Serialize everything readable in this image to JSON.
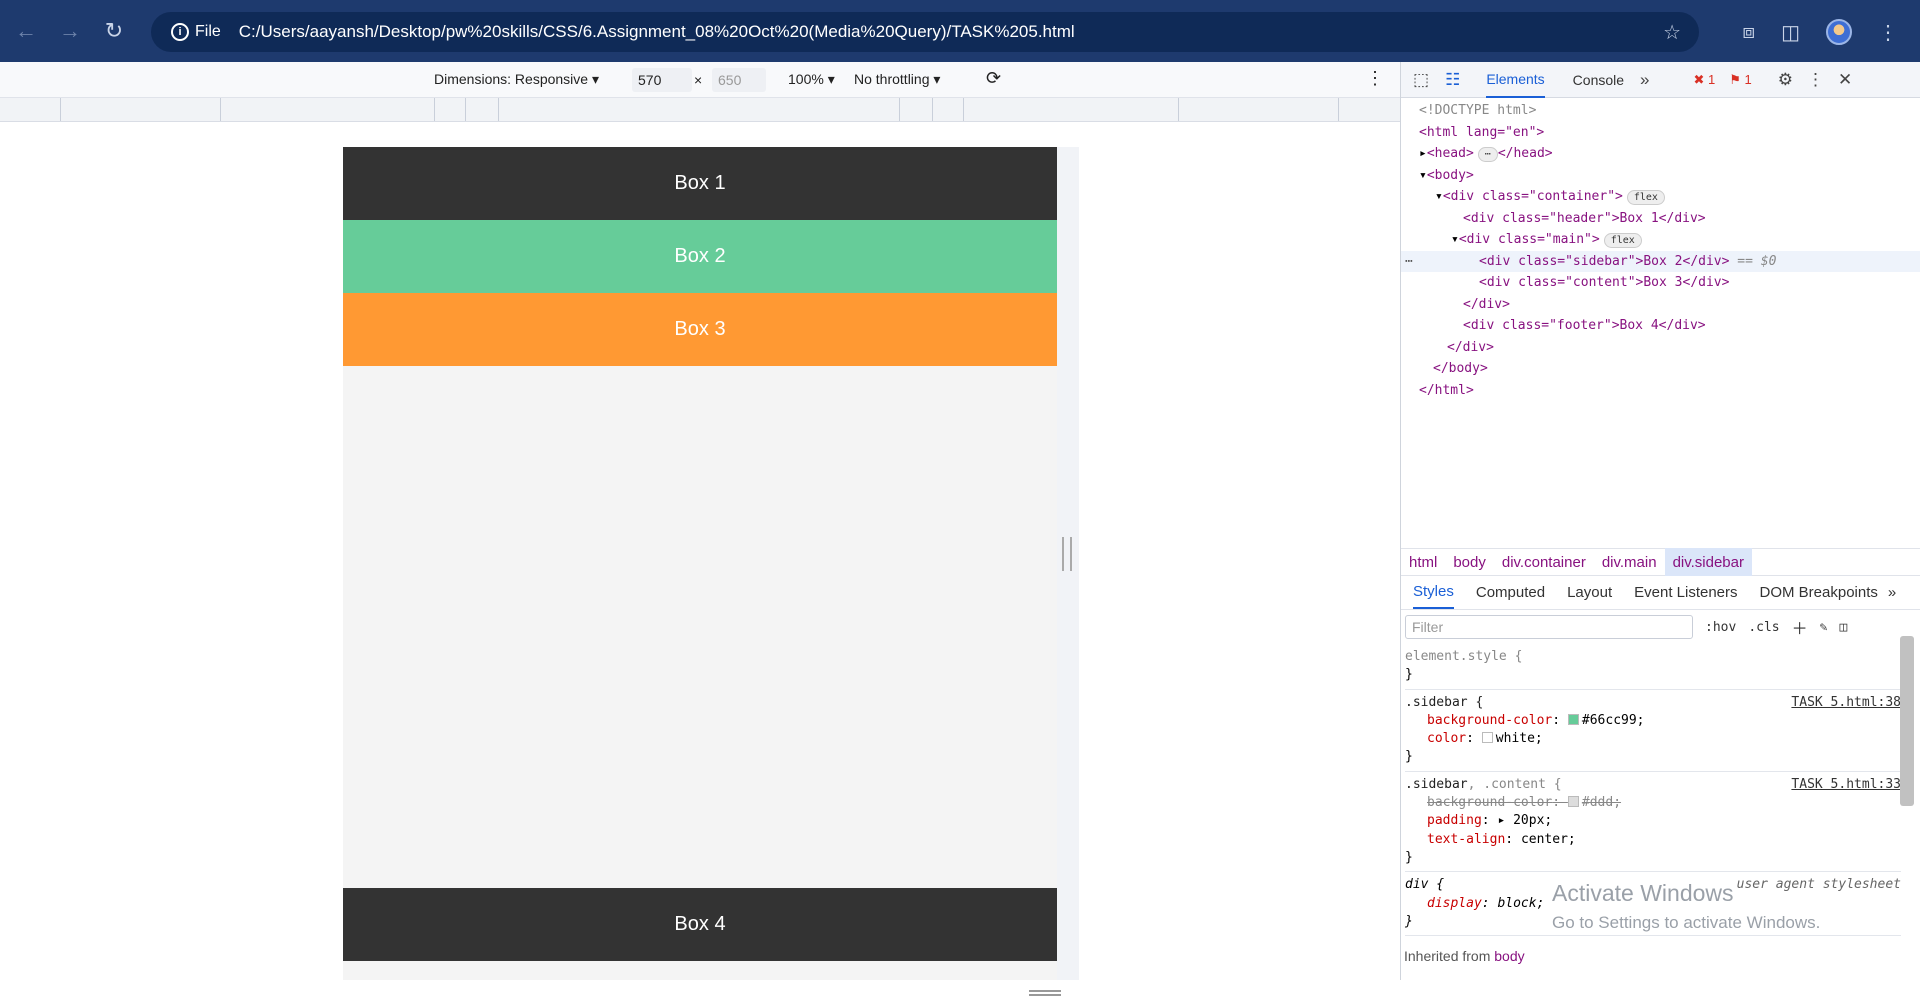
{
  "browser": {
    "chip_label": "File",
    "url": "C:/Users/aayansh/Desktop/pw%20skills/CSS/6.Assignment_08%20Oct%20(Media%20Query)/TASK%205.html"
  },
  "device_toolbar": {
    "dimensions_label": "Dimensions: Responsive",
    "width": "570",
    "x_sep": "×",
    "height": "650",
    "zoom": "100%",
    "throttling": "No throttling"
  },
  "page": {
    "box1": "Box 1",
    "box2": "Box 2",
    "box3": "Box 3",
    "box4": "Box 4"
  },
  "devtools": {
    "tabs": [
      "Elements",
      "Console"
    ],
    "error_count": "1",
    "issue_count": "1",
    "dom": {
      "doctype": "<!DOCTYPE html>",
      "html_open": "<html lang=\"en\">",
      "head": "<head>",
      "head_close": "</head>",
      "body_open": "<body>",
      "container_open": "<div class=\"container\">",
      "flex": "flex",
      "header_line": "<div class=\"header\">Box 1</div>",
      "main_open": "<div class=\"main\">",
      "sidebar_line": "<div class=\"sidebar\">Box 2</div>",
      "sidebar_ref": "== $0",
      "content_line": "<div class=\"content\">Box 3</div>",
      "div_close": "</div>",
      "footer_line": "<div class=\"footer\">Box 4</div>",
      "body_close": "</body>",
      "html_close": "</html>"
    },
    "breadcrumbs": [
      "html",
      "body",
      "div.container",
      "div.main",
      "div.sidebar"
    ],
    "style_tabs": [
      "Styles",
      "Computed",
      "Layout",
      "Event Listeners",
      "DOM Breakpoints"
    ],
    "filter_placeholder": "Filter",
    "hov": ":hov",
    "cls": ".cls",
    "rules": {
      "element_style": "element.style {",
      "close": "}",
      "r1_sel": ".sidebar {",
      "r1_src": "TASK 5.html:38",
      "r1_p1_name": "background-color",
      "r1_p1_val": "#66cc99;",
      "r1_p2_name": "color",
      "r1_p2_val": "white;",
      "r2_sel_a": ".sidebar",
      "r2_sel_b": ", .content {",
      "r2_src": "TASK 5.html:33",
      "r2_p1_name": "background-color",
      "r2_p1_val": "#ddd;",
      "r2_p2_name": "padding",
      "r2_p2_val": "20px;",
      "r2_p3_name": "text-align",
      "r2_p3_val": "center;",
      "r3_sel": "div {",
      "r3_src": "user agent stylesheet",
      "r3_p1_name": "display",
      "r3_p1_val": "block;"
    },
    "inherited_label": "Inherited from",
    "inherited_from": "body"
  },
  "watermark": {
    "line1": "Activate Windows",
    "line2": "Go to Settings to activate Windows."
  },
  "colors": {
    "box1": "#333333",
    "box2": "#66cc99",
    "box3": "#ff9933",
    "box4": "#333333",
    "accent": "#1a5fd6"
  }
}
